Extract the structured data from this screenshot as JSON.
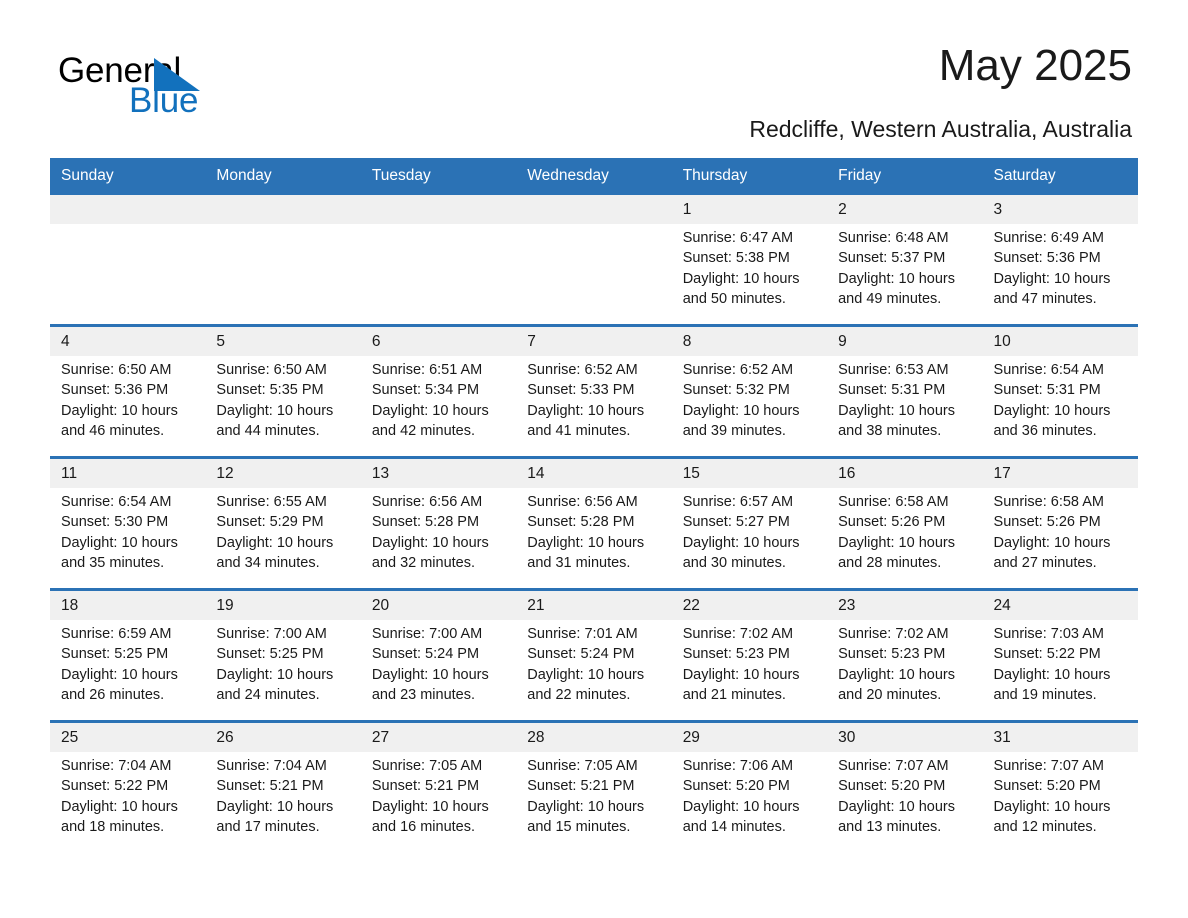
{
  "brand": {
    "name_part1": "General",
    "name_part2": "Blue",
    "triangle_color": "#1271bd",
    "accent_color": "#2b72b5"
  },
  "header": {
    "month_title": "May 2025",
    "location": "Redcliffe, Western Australia, Australia"
  },
  "calendar": {
    "weekday_headers": [
      "Sunday",
      "Monday",
      "Tuesday",
      "Wednesday",
      "Thursday",
      "Friday",
      "Saturday"
    ],
    "weeks": [
      [
        {
          "day": "",
          "sunrise": "",
          "sunset": "",
          "daylight_line1": "",
          "daylight_line2": ""
        },
        {
          "day": "",
          "sunrise": "",
          "sunset": "",
          "daylight_line1": "",
          "daylight_line2": ""
        },
        {
          "day": "",
          "sunrise": "",
          "sunset": "",
          "daylight_line1": "",
          "daylight_line2": ""
        },
        {
          "day": "",
          "sunrise": "",
          "sunset": "",
          "daylight_line1": "",
          "daylight_line2": ""
        },
        {
          "day": "1",
          "sunrise": "Sunrise: 6:47 AM",
          "sunset": "Sunset: 5:38 PM",
          "daylight_line1": "Daylight: 10 hours",
          "daylight_line2": "and 50 minutes."
        },
        {
          "day": "2",
          "sunrise": "Sunrise: 6:48 AM",
          "sunset": "Sunset: 5:37 PM",
          "daylight_line1": "Daylight: 10 hours",
          "daylight_line2": "and 49 minutes."
        },
        {
          "day": "3",
          "sunrise": "Sunrise: 6:49 AM",
          "sunset": "Sunset: 5:36 PM",
          "daylight_line1": "Daylight: 10 hours",
          "daylight_line2": "and 47 minutes."
        }
      ],
      [
        {
          "day": "4",
          "sunrise": "Sunrise: 6:50 AM",
          "sunset": "Sunset: 5:36 PM",
          "daylight_line1": "Daylight: 10 hours",
          "daylight_line2": "and 46 minutes."
        },
        {
          "day": "5",
          "sunrise": "Sunrise: 6:50 AM",
          "sunset": "Sunset: 5:35 PM",
          "daylight_line1": "Daylight: 10 hours",
          "daylight_line2": "and 44 minutes."
        },
        {
          "day": "6",
          "sunrise": "Sunrise: 6:51 AM",
          "sunset": "Sunset: 5:34 PM",
          "daylight_line1": "Daylight: 10 hours",
          "daylight_line2": "and 42 minutes."
        },
        {
          "day": "7",
          "sunrise": "Sunrise: 6:52 AM",
          "sunset": "Sunset: 5:33 PM",
          "daylight_line1": "Daylight: 10 hours",
          "daylight_line2": "and 41 minutes."
        },
        {
          "day": "8",
          "sunrise": "Sunrise: 6:52 AM",
          "sunset": "Sunset: 5:32 PM",
          "daylight_line1": "Daylight: 10 hours",
          "daylight_line2": "and 39 minutes."
        },
        {
          "day": "9",
          "sunrise": "Sunrise: 6:53 AM",
          "sunset": "Sunset: 5:31 PM",
          "daylight_line1": "Daylight: 10 hours",
          "daylight_line2": "and 38 minutes."
        },
        {
          "day": "10",
          "sunrise": "Sunrise: 6:54 AM",
          "sunset": "Sunset: 5:31 PM",
          "daylight_line1": "Daylight: 10 hours",
          "daylight_line2": "and 36 minutes."
        }
      ],
      [
        {
          "day": "11",
          "sunrise": "Sunrise: 6:54 AM",
          "sunset": "Sunset: 5:30 PM",
          "daylight_line1": "Daylight: 10 hours",
          "daylight_line2": "and 35 minutes."
        },
        {
          "day": "12",
          "sunrise": "Sunrise: 6:55 AM",
          "sunset": "Sunset: 5:29 PM",
          "daylight_line1": "Daylight: 10 hours",
          "daylight_line2": "and 34 minutes."
        },
        {
          "day": "13",
          "sunrise": "Sunrise: 6:56 AM",
          "sunset": "Sunset: 5:28 PM",
          "daylight_line1": "Daylight: 10 hours",
          "daylight_line2": "and 32 minutes."
        },
        {
          "day": "14",
          "sunrise": "Sunrise: 6:56 AM",
          "sunset": "Sunset: 5:28 PM",
          "daylight_line1": "Daylight: 10 hours",
          "daylight_line2": "and 31 minutes."
        },
        {
          "day": "15",
          "sunrise": "Sunrise: 6:57 AM",
          "sunset": "Sunset: 5:27 PM",
          "daylight_line1": "Daylight: 10 hours",
          "daylight_line2": "and 30 minutes."
        },
        {
          "day": "16",
          "sunrise": "Sunrise: 6:58 AM",
          "sunset": "Sunset: 5:26 PM",
          "daylight_line1": "Daylight: 10 hours",
          "daylight_line2": "and 28 minutes."
        },
        {
          "day": "17",
          "sunrise": "Sunrise: 6:58 AM",
          "sunset": "Sunset: 5:26 PM",
          "daylight_line1": "Daylight: 10 hours",
          "daylight_line2": "and 27 minutes."
        }
      ],
      [
        {
          "day": "18",
          "sunrise": "Sunrise: 6:59 AM",
          "sunset": "Sunset: 5:25 PM",
          "daylight_line1": "Daylight: 10 hours",
          "daylight_line2": "and 26 minutes."
        },
        {
          "day": "19",
          "sunrise": "Sunrise: 7:00 AM",
          "sunset": "Sunset: 5:25 PM",
          "daylight_line1": "Daylight: 10 hours",
          "daylight_line2": "and 24 minutes."
        },
        {
          "day": "20",
          "sunrise": "Sunrise: 7:00 AM",
          "sunset": "Sunset: 5:24 PM",
          "daylight_line1": "Daylight: 10 hours",
          "daylight_line2": "and 23 minutes."
        },
        {
          "day": "21",
          "sunrise": "Sunrise: 7:01 AM",
          "sunset": "Sunset: 5:24 PM",
          "daylight_line1": "Daylight: 10 hours",
          "daylight_line2": "and 22 minutes."
        },
        {
          "day": "22",
          "sunrise": "Sunrise: 7:02 AM",
          "sunset": "Sunset: 5:23 PM",
          "daylight_line1": "Daylight: 10 hours",
          "daylight_line2": "and 21 minutes."
        },
        {
          "day": "23",
          "sunrise": "Sunrise: 7:02 AM",
          "sunset": "Sunset: 5:23 PM",
          "daylight_line1": "Daylight: 10 hours",
          "daylight_line2": "and 20 minutes."
        },
        {
          "day": "24",
          "sunrise": "Sunrise: 7:03 AM",
          "sunset": "Sunset: 5:22 PM",
          "daylight_line1": "Daylight: 10 hours",
          "daylight_line2": "and 19 minutes."
        }
      ],
      [
        {
          "day": "25",
          "sunrise": "Sunrise: 7:04 AM",
          "sunset": "Sunset: 5:22 PM",
          "daylight_line1": "Daylight: 10 hours",
          "daylight_line2": "and 18 minutes."
        },
        {
          "day": "26",
          "sunrise": "Sunrise: 7:04 AM",
          "sunset": "Sunset: 5:21 PM",
          "daylight_line1": "Daylight: 10 hours",
          "daylight_line2": "and 17 minutes."
        },
        {
          "day": "27",
          "sunrise": "Sunrise: 7:05 AM",
          "sunset": "Sunset: 5:21 PM",
          "daylight_line1": "Daylight: 10 hours",
          "daylight_line2": "and 16 minutes."
        },
        {
          "day": "28",
          "sunrise": "Sunrise: 7:05 AM",
          "sunset": "Sunset: 5:21 PM",
          "daylight_line1": "Daylight: 10 hours",
          "daylight_line2": "and 15 minutes."
        },
        {
          "day": "29",
          "sunrise": "Sunrise: 7:06 AM",
          "sunset": "Sunset: 5:20 PM",
          "daylight_line1": "Daylight: 10 hours",
          "daylight_line2": "and 14 minutes."
        },
        {
          "day": "30",
          "sunrise": "Sunrise: 7:07 AM",
          "sunset": "Sunset: 5:20 PM",
          "daylight_line1": "Daylight: 10 hours",
          "daylight_line2": "and 13 minutes."
        },
        {
          "day": "31",
          "sunrise": "Sunrise: 7:07 AM",
          "sunset": "Sunset: 5:20 PM",
          "daylight_line1": "Daylight: 10 hours",
          "daylight_line2": "and 12 minutes."
        }
      ]
    ]
  }
}
